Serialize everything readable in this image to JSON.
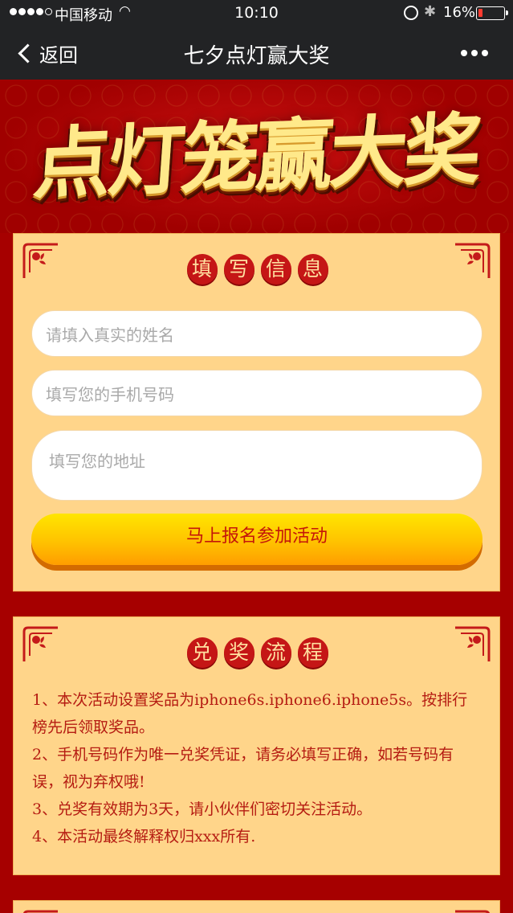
{
  "status_bar": {
    "carrier": "中国移动",
    "time": "10:10",
    "battery_percent": "16%",
    "battery_level": 0.16
  },
  "nav": {
    "back_label": "返回",
    "title": "七夕点灯赢大奖"
  },
  "banner": {
    "title": "点灯笼赢大奖"
  },
  "form": {
    "heading": [
      "填",
      "写",
      "信",
      "息"
    ],
    "name_placeholder": "请填入真实的姓名",
    "phone_placeholder": "填写您的手机号码",
    "address_placeholder": "填写您的地址",
    "submit_label": "马上报名参加活动"
  },
  "rules": {
    "heading": [
      "兑",
      "奖",
      "流",
      "程"
    ],
    "items": [
      "1、本次活动设置奖品为iphone6s.iphone6.iphone5s。按排行榜先后领取奖品。",
      "2、手机号码作为唯一兑奖凭证，请务必填写正确，如若号码有误，视为弃权哦!",
      "3、兑奖有效期为3天，请小伙伴们密切关注活动。",
      "4、本活动最终解释权归xxx所有."
    ]
  },
  "colors": {
    "page_bg": "#a60000",
    "panel_bg": "#ffd58a",
    "accent_red": "#c51616",
    "button_yellow": "#ffc200"
  }
}
